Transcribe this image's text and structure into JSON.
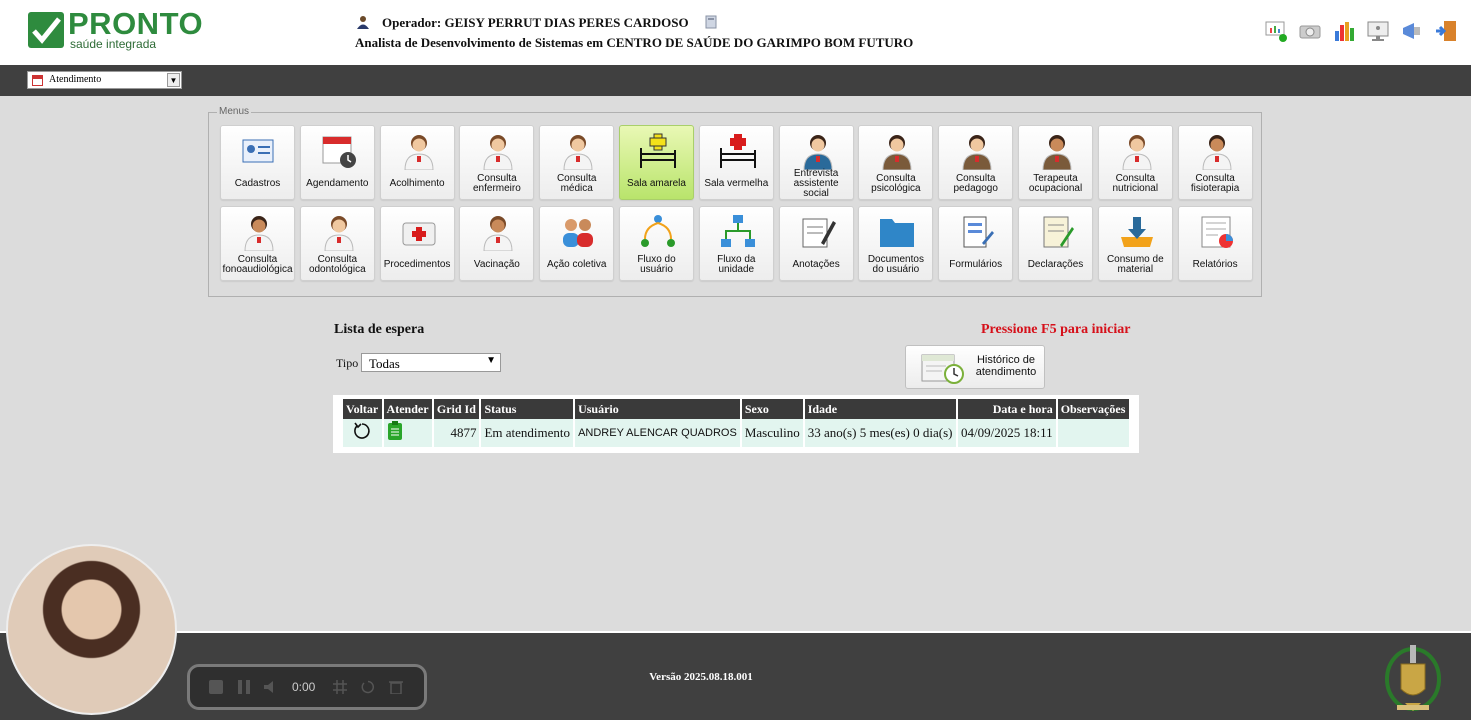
{
  "header": {
    "logo": {
      "title": "PRONTO",
      "subtitle": "saúde integrada"
    },
    "operator": "Operador: GEISY PERRUT DIAS PERES CARDOSO",
    "role": "Analista de Desenvolvimento de Sistemas em CENTRO DE SAÚDE DO GARIMPO BOM FUTURO",
    "top_icons": [
      "presentation-chart-icon",
      "camera-icon",
      "bar-chart-icon",
      "monitor-info-icon",
      "megaphone-icon",
      "logout-door-icon"
    ]
  },
  "navbar": {
    "module_select": "Atendimento"
  },
  "menus": {
    "legend": "Menus",
    "rows": [
      [
        {
          "label": "Cadastros",
          "icon": "id-card-icon"
        },
        {
          "label": "Agendamento",
          "icon": "calendar-clock-icon"
        },
        {
          "label": "Acolhimento",
          "icon": "nurse-icon"
        },
        {
          "label": "Consulta enfermeiro",
          "icon": "male-nurse-icon"
        },
        {
          "label": "Consulta médica",
          "icon": "doctor-icon"
        },
        {
          "label": "Sala amarela",
          "icon": "bed-yellow-cross-icon",
          "highlight": true
        },
        {
          "label": "Sala vermelha",
          "icon": "bed-red-cross-icon"
        },
        {
          "label": "Entrevista assistente social",
          "icon": "social-worker-icon"
        },
        {
          "label": "Consulta psicológica",
          "icon": "psychologist-icon"
        },
        {
          "label": "Consulta pedagogo",
          "icon": "pedagogue-icon"
        },
        {
          "label": "Terapeuta ocupacional",
          "icon": "therapist-icon"
        },
        {
          "label": "Consulta nutricional",
          "icon": "nutritionist-icon"
        },
        {
          "label": "Consulta fisioterapia",
          "icon": "physiotherapist-icon"
        }
      ],
      [
        {
          "label": "Consulta fonoaudiológica",
          "icon": "speech-therapist-icon"
        },
        {
          "label": "Consulta odontológica",
          "icon": "dentist-icon"
        },
        {
          "label": "Procedimentos",
          "icon": "first-aid-kit-icon"
        },
        {
          "label": "Vacinação",
          "icon": "vaccine-nurse-icon"
        },
        {
          "label": "Ação coletiva",
          "icon": "group-icon"
        },
        {
          "label": "Fluxo do usuário",
          "icon": "user-flow-icon"
        },
        {
          "label": "Fluxo da unidade",
          "icon": "unit-flow-icon"
        },
        {
          "label": "Anotações",
          "icon": "notes-pencil-icon"
        },
        {
          "label": "Documentos do usuário",
          "icon": "folder-icon"
        },
        {
          "label": "Formulários",
          "icon": "form-icon"
        },
        {
          "label": "Declarações",
          "icon": "declaration-icon"
        },
        {
          "label": "Consumo de material",
          "icon": "material-download-icon"
        },
        {
          "label": "Relatórios",
          "icon": "report-icon"
        }
      ]
    ]
  },
  "waiting_list": {
    "title": "Lista de espera",
    "notice": "Pressione F5 para iniciar",
    "tipo_label": "Tipo",
    "tipo_value": "Todas",
    "history_button": "Histórico de atendimento",
    "columns": [
      "Voltar",
      "Atender",
      "Grid Id",
      "Status",
      "Usuário",
      "Sexo",
      "Idade",
      "Data e hora",
      "Observações"
    ],
    "rows": [
      {
        "grid_id": "4877",
        "status": "Em atendimento",
        "usuario": "ANDREY ALENCAR QUADROS",
        "sexo": "Masculino",
        "idade": "33 ano(s) 5 mes(es) 0 dia(s)",
        "data_hora": "04/09/2025 18:11",
        "observacoes": ""
      }
    ]
  },
  "footer": {
    "version": "Versão 2025.08.18.001"
  },
  "recorder": {
    "time": "0:00"
  },
  "colors": {
    "brand_green": "#2e8b3e",
    "alert_red": "#d6101a",
    "bar_dark": "#404040",
    "highlight_tile": "#b9e46c"
  }
}
